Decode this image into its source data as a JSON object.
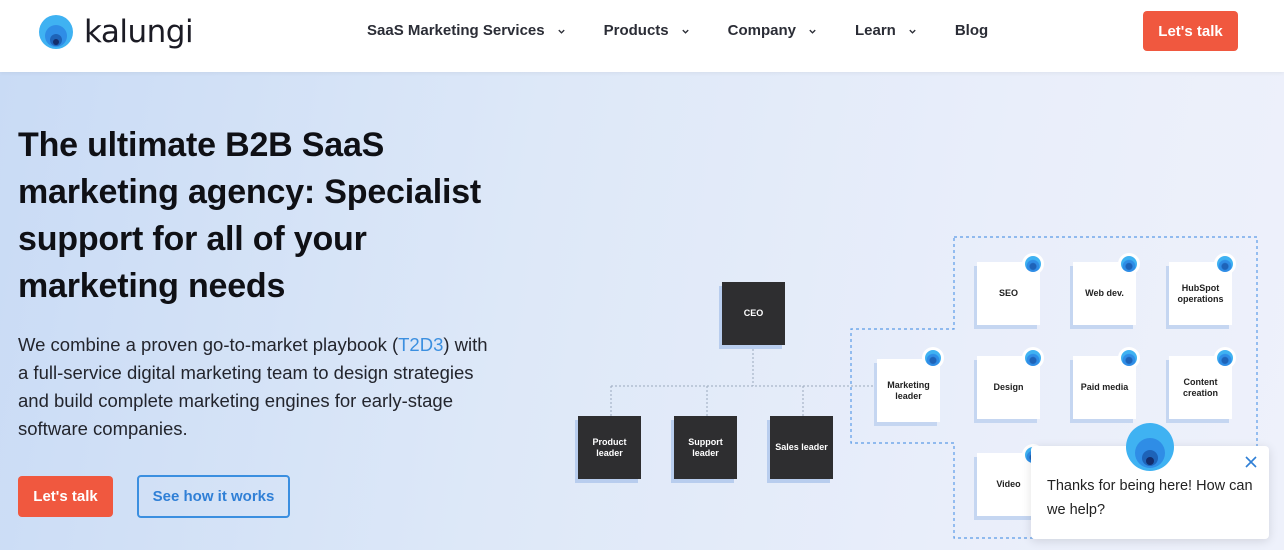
{
  "brand": {
    "name": "kalungi",
    "accent": "#f0583f",
    "link_color": "#3b8fe0"
  },
  "nav": {
    "items": [
      {
        "label": "SaaS Marketing Services",
        "dropdown": true
      },
      {
        "label": "Products",
        "dropdown": true
      },
      {
        "label": "Company",
        "dropdown": true
      },
      {
        "label": "Learn",
        "dropdown": true
      },
      {
        "label": "Blog",
        "dropdown": false
      }
    ],
    "cta_label": "Let's talk"
  },
  "hero": {
    "title": "The ultimate B2B SaaS marketing agency: Specialist support for all of your marketing needs",
    "desc_before": "We combine a proven go-to-market playbook (",
    "desc_link": "T2D3",
    "desc_after": ") with a full-service digital marketing team to design strategies and build complete marketing engines for early-stage software companies.",
    "primary_button": "Let's talk",
    "secondary_button": "See how it works"
  },
  "org_chart": {
    "ceo": "CEO",
    "leaders": [
      "Product leader",
      "Support leader",
      "Sales leader"
    ],
    "marketing_leader": "Marketing leader",
    "team": [
      "SEO",
      "Web dev.",
      "HubSpot operations",
      "Design",
      "Paid media",
      "Content creation",
      "Video"
    ]
  },
  "chat": {
    "message": "Thanks for being here! How can we help?"
  },
  "icons": {
    "logo": "kalungi-logo-icon",
    "chevron": "chevron-down-icon",
    "close": "close-icon",
    "avatar": "chat-avatar-icon"
  }
}
